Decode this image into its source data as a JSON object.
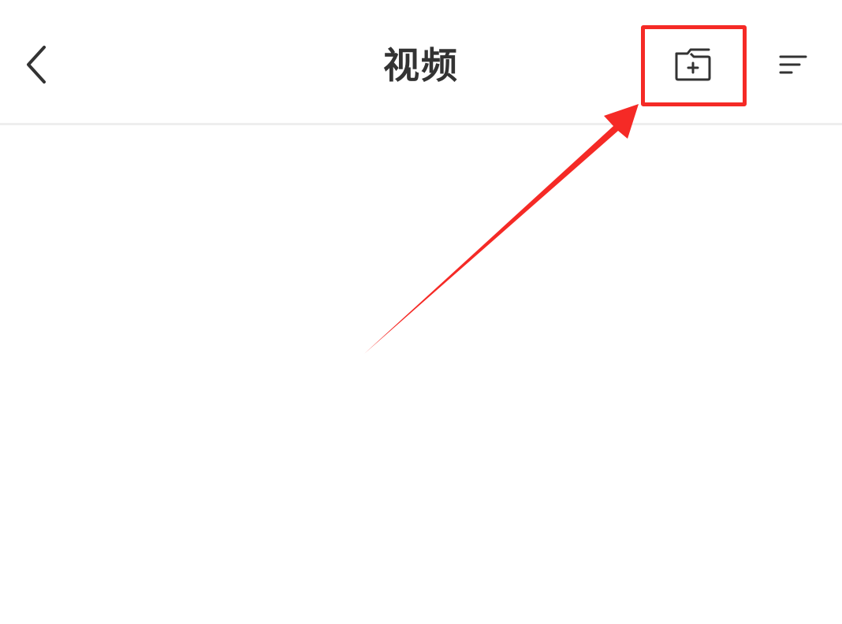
{
  "header": {
    "title": "视频",
    "back_icon": "chevron-left-icon",
    "new_folder_icon": "folder-plus-icon",
    "sort_icon": "sort-lines-icon"
  },
  "annotation": {
    "highlight_color": "#f52a26",
    "target": "new-folder-button"
  },
  "colors": {
    "title_text": "#333333",
    "icon": "#333333",
    "divider": "#eeeeee",
    "background": "#ffffff"
  }
}
